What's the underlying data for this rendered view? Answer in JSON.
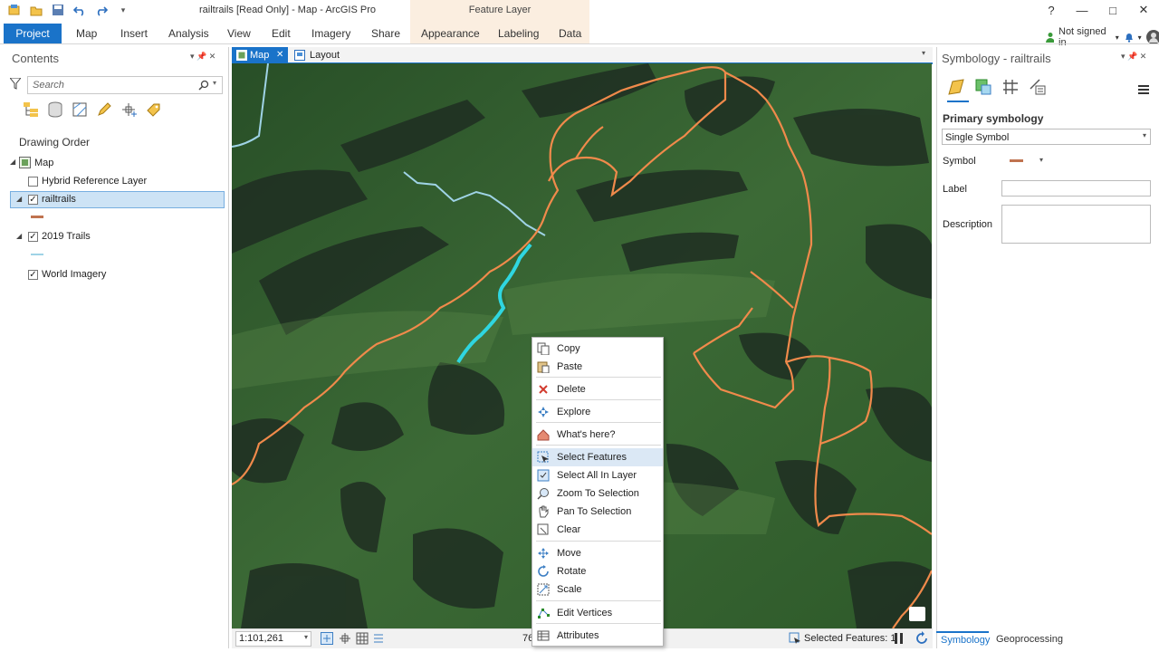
{
  "app": {
    "title": "railtrails [Read Only] - Map - ArcGIS Pro",
    "context_group": "Feature Layer",
    "signin": "Not signed in",
    "help": "?"
  },
  "ribbon": {
    "tabs": [
      "Project",
      "Map",
      "Insert",
      "Analysis",
      "View",
      "Edit",
      "Imagery",
      "Share",
      "Appearance",
      "Labeling",
      "Data"
    ]
  },
  "contents": {
    "title": "Contents",
    "search_placeholder": "Search",
    "drawing_order": "Drawing Order",
    "layers": {
      "map": "Map",
      "hybrid": "Hybrid Reference Layer",
      "railtrails": "railtrails",
      "trails": "2019 Trails",
      "imagery": "World Imagery"
    }
  },
  "map_view": {
    "tab_map": "Map",
    "tab_layout": "Layout",
    "scale": "1:101,261",
    "coord_partial": "76",
    "selected_features": "Selected Features: 1"
  },
  "context_menu": {
    "items": [
      "Copy",
      "Paste",
      "Delete",
      "Explore",
      "What's here?",
      "Select Features",
      "Select All In Layer",
      "Zoom To Selection",
      "Pan To Selection",
      "Clear",
      "Move",
      "Rotate",
      "Scale",
      "Edit Vertices",
      "Attributes"
    ]
  },
  "symbology": {
    "title": "Symbology - railtrails",
    "primary": "Primary symbology",
    "type_value": "Single Symbol",
    "symbol_label": "Symbol",
    "label_label": "Label",
    "description_label": "Description",
    "label_value": "",
    "description_value": "",
    "symbol_color": "#c0734f"
  },
  "bottom_tabs": [
    "Symbology",
    "Geoprocessing"
  ],
  "colors": {
    "accent": "#1a73c9",
    "rail_lines": "#f08a4b",
    "trail_lines": "#9fd3e6",
    "selected_trail": "#2fd6e0"
  }
}
